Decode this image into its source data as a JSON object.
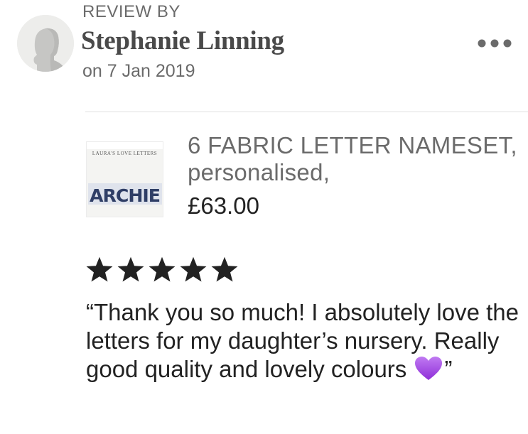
{
  "header": {
    "review_by_label": "REVIEW BY",
    "reviewer_name": "Stephanie Linning",
    "review_date": "on 7 Jan 2019",
    "more_menu_icon": "more-horizontal-icon"
  },
  "avatar": {
    "icon": "default-user-silhouette-icon"
  },
  "product": {
    "title": "6 FABRIC LETTER NAMESET, personalised,",
    "price": "£63.00",
    "thumbnail": {
      "banner_text": "LAURA'S LOVE LETTERS",
      "letters_text": "ARCHIE"
    }
  },
  "review": {
    "rating": 5,
    "rating_max": 5,
    "text_before_emoji": "“Thank you so much! I absolutely love the letters for my daughter’s nursery. Really good quality and lovely colours ",
    "emoji": "purple-heart-icon",
    "text_after_emoji": "”"
  },
  "colors": {
    "star": "#222222",
    "muted_text": "#6b6b6b",
    "heart": "#a74be6",
    "divider": "#e1e1e1"
  }
}
